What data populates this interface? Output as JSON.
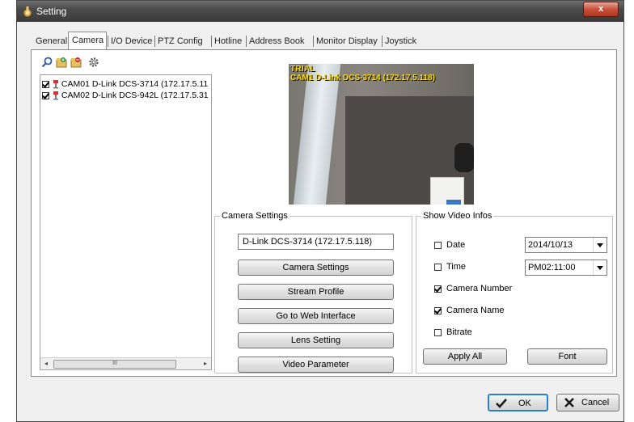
{
  "window": {
    "title": "Setting",
    "close_label": "x"
  },
  "tabs": [
    {
      "label": "General"
    },
    {
      "label": "Camera"
    },
    {
      "label": "I/O Device"
    },
    {
      "label": "PTZ Config"
    },
    {
      "label": "Hotline"
    },
    {
      "label": "Address Book"
    },
    {
      "label": "Monitor Display"
    },
    {
      "label": "Joystick"
    }
  ],
  "active_tab": "Camera",
  "toolbar": {
    "icons": [
      "search-icon",
      "add-camera-icon",
      "remove-camera-icon",
      "settings-gear-icon"
    ]
  },
  "camera_list": [
    {
      "checked": true,
      "label": "CAM01 D-Link DCS-3714 (172.17.5.11"
    },
    {
      "checked": true,
      "label": "CAM02 D-Link DCS-942L (172.17.5.31"
    }
  ],
  "scrollbar": {
    "left_arrow": "◂",
    "thumb": "III",
    "right_arrow": "▸"
  },
  "video": {
    "watermark": "TRIAL",
    "caption": "CAM1 D-Link DCS-3714 (172.17.5.118)"
  },
  "camera_settings": {
    "legend": "Camera Settings",
    "camera_name": "D-Link DCS-3714 (172.17.5.118)",
    "buttons": [
      "Camera Settings",
      "Stream Profile",
      "Go to Web Interface",
      "Lens Setting",
      "Video Parameter"
    ]
  },
  "show_video_infos": {
    "legend": "Show Video Infos",
    "options": [
      {
        "label": "Date",
        "checked": false
      },
      {
        "label": "Time",
        "checked": false
      },
      {
        "label": "Camera Number",
        "checked": true
      },
      {
        "label": "Camera Name",
        "checked": true
      },
      {
        "label": "Bitrate",
        "checked": false
      }
    ],
    "date_value": "2014/10/13",
    "time_value": "PM02:11:00",
    "apply_all_label": "Apply All",
    "font_label": "Font"
  },
  "footer": {
    "ok_label": "OK",
    "cancel_label": "Cancel"
  },
  "colors": {
    "titlebar": "#4a4a4a",
    "close_button": "#c7503a",
    "video_text": "#ffe000",
    "default_button_border": "#2b7fd0"
  }
}
